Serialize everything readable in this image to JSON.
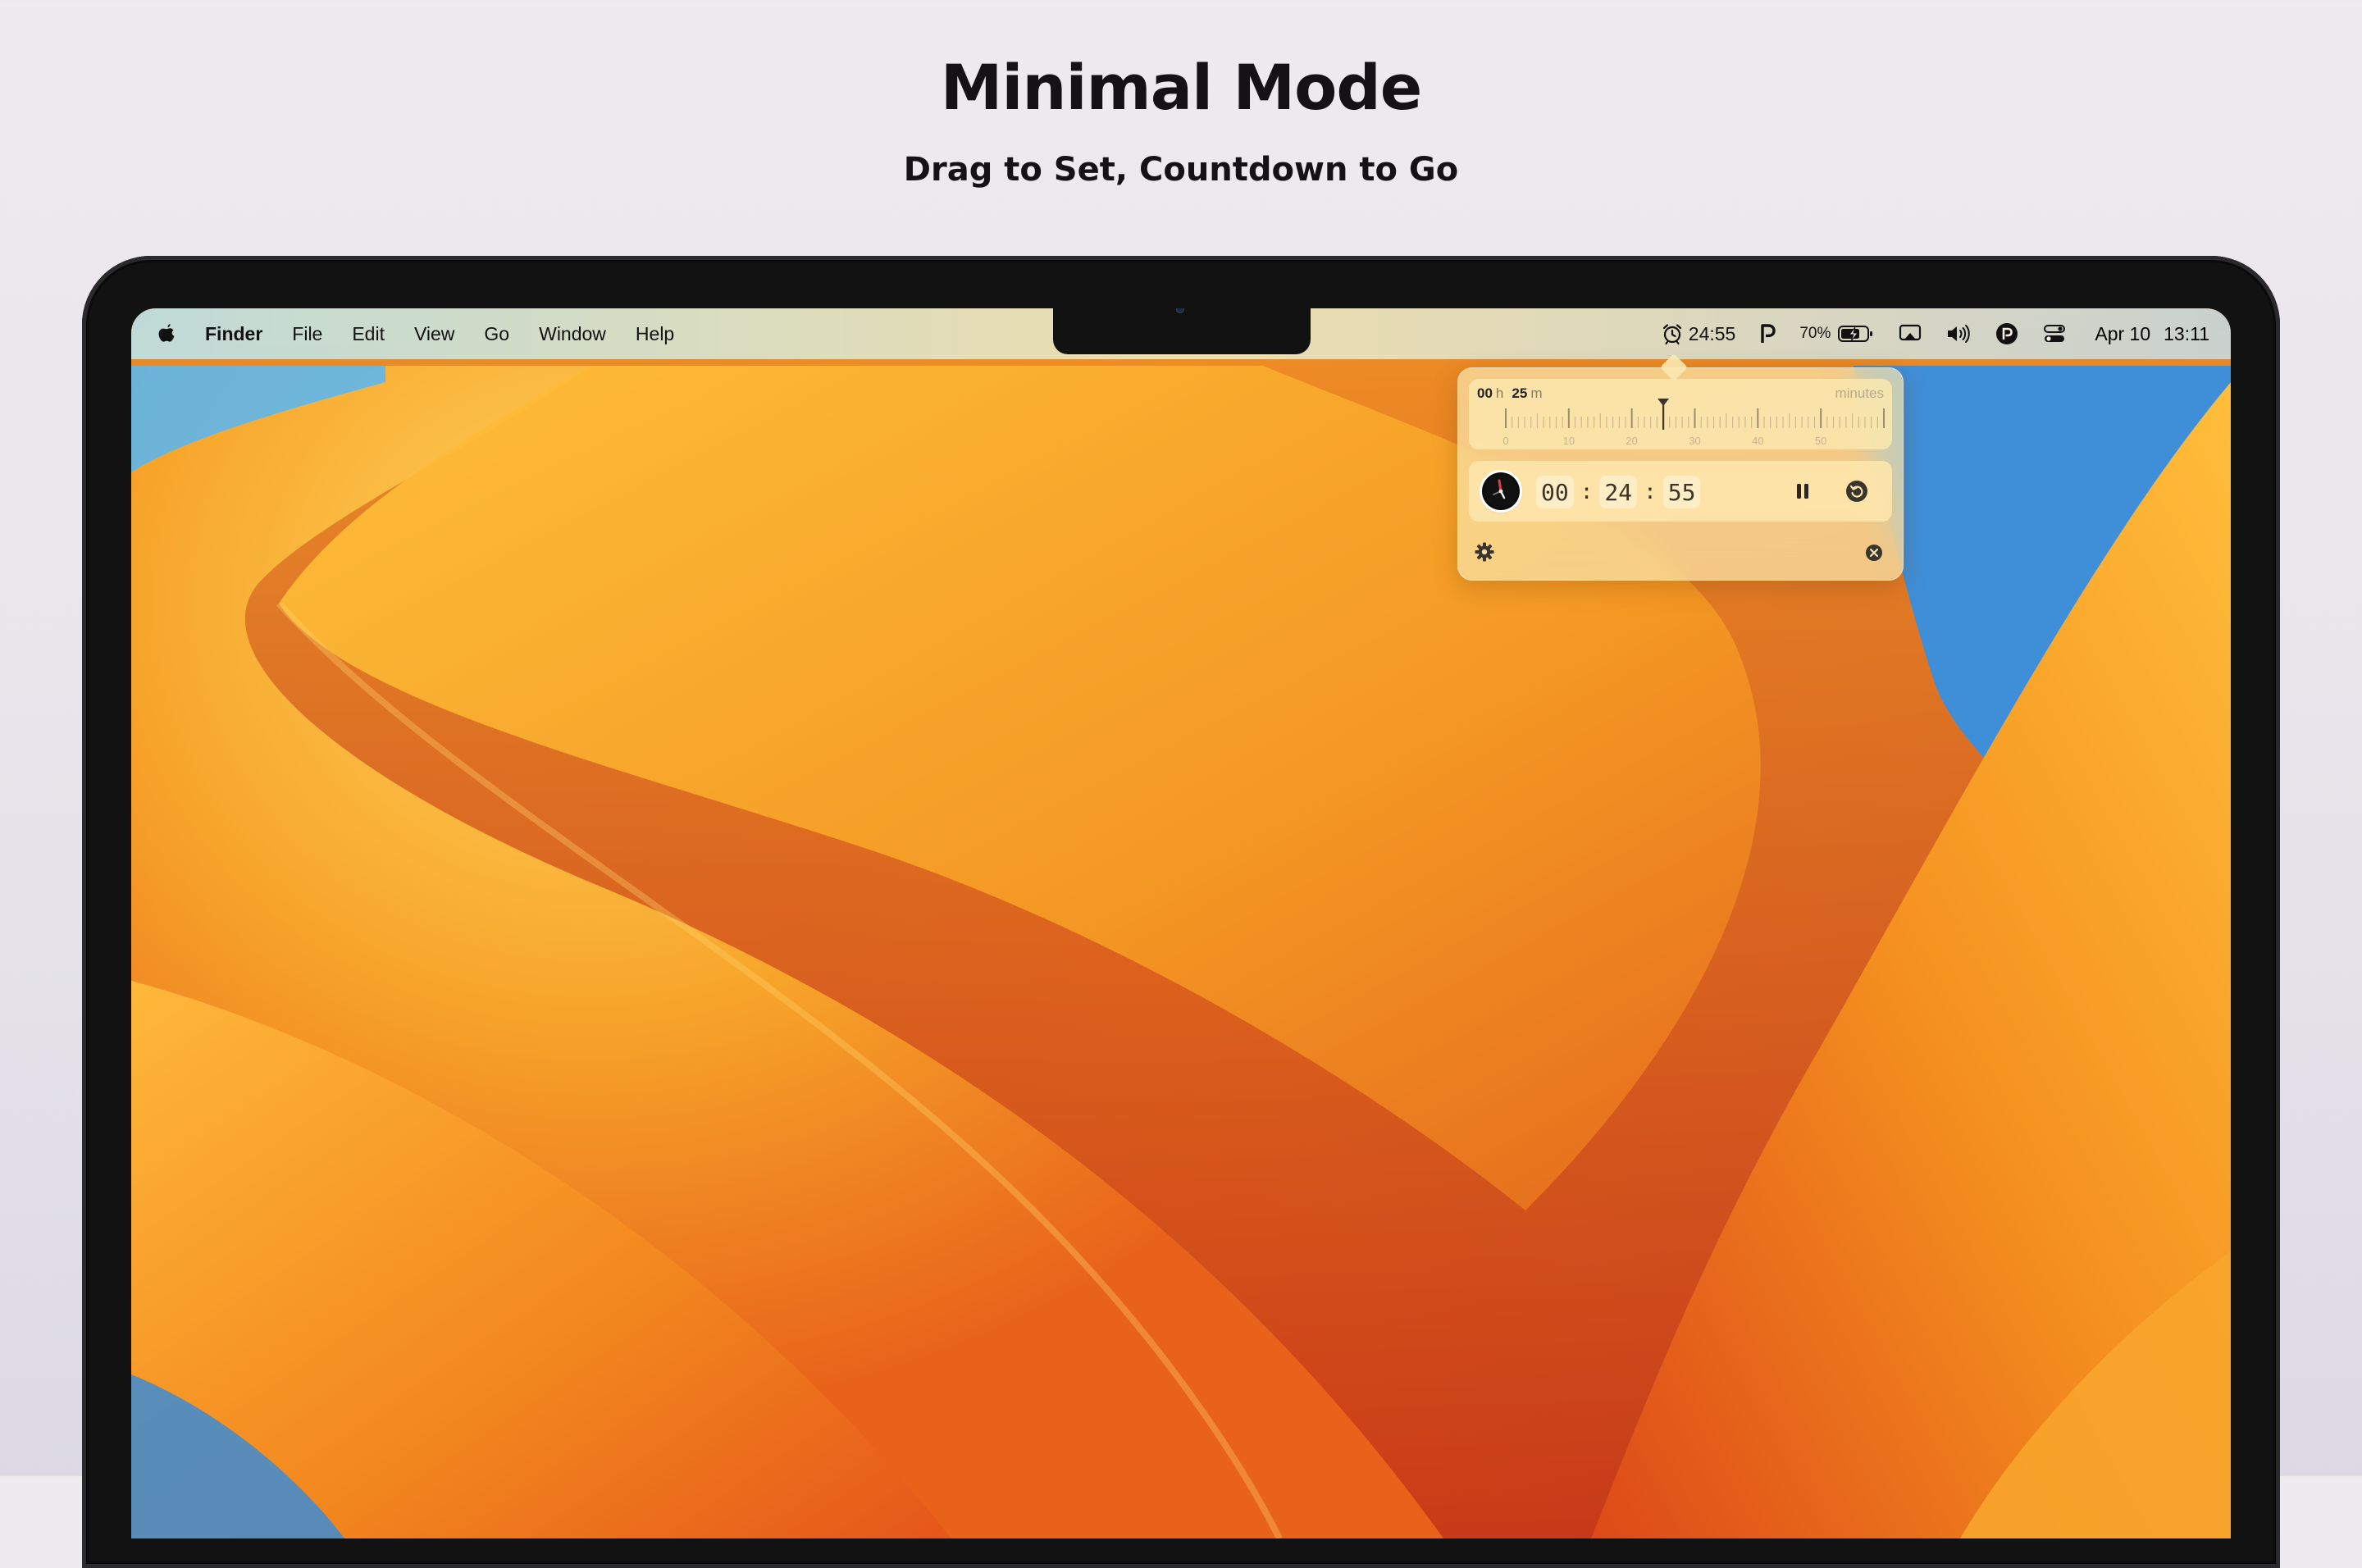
{
  "headline": {
    "title": "Minimal Mode",
    "subtitle": "Drag to Set, Countdown to Go"
  },
  "menubar": {
    "app_name": "Finder",
    "items": [
      "File",
      "Edit",
      "View",
      "Go",
      "Window",
      "Help"
    ],
    "status": {
      "timer": "24:55",
      "battery_percent": "70%",
      "date": "Apr 10",
      "time": "13:11"
    },
    "icons": [
      "apple-icon",
      "alarm-clock-icon",
      "p-app-icon",
      "battery-charging-icon",
      "screen-mirroring-icon",
      "volume-icon",
      "app-icon",
      "control-center-icon"
    ]
  },
  "popover": {
    "ruler": {
      "hours": "00",
      "hours_unit": "h",
      "minutes": "25",
      "minutes_unit": "m",
      "unit_label": "minutes",
      "scale_labels": [
        "0",
        "10",
        "20",
        "30",
        "40",
        "50"
      ],
      "selected_minutes": 25
    },
    "countdown": {
      "hours": "00",
      "minutes": "24",
      "seconds": "55",
      "separator": ":"
    },
    "icons": [
      "pause-icon",
      "reset-icon",
      "gear-icon",
      "close-icon"
    ]
  },
  "colors": {
    "accent_orange": "#f29a1f",
    "deep_orange": "#e2521a",
    "sky_blue": "#4f9ee0"
  }
}
